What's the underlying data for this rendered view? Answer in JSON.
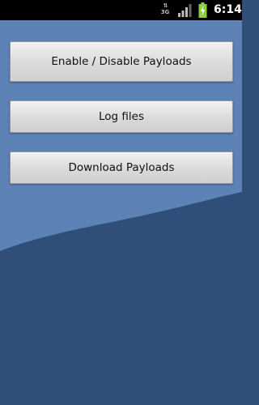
{
  "status_bar": {
    "network": "3G",
    "time": "6:14"
  },
  "buttons": {
    "enable_disable": "Enable / Disable Payloads",
    "log_files": "Log files",
    "download": "Download Payloads"
  },
  "colors": {
    "wallpaper_light": "#5c82b6",
    "wallpaper_dark": "#2f4f78",
    "battery": "#8ccf3a"
  }
}
